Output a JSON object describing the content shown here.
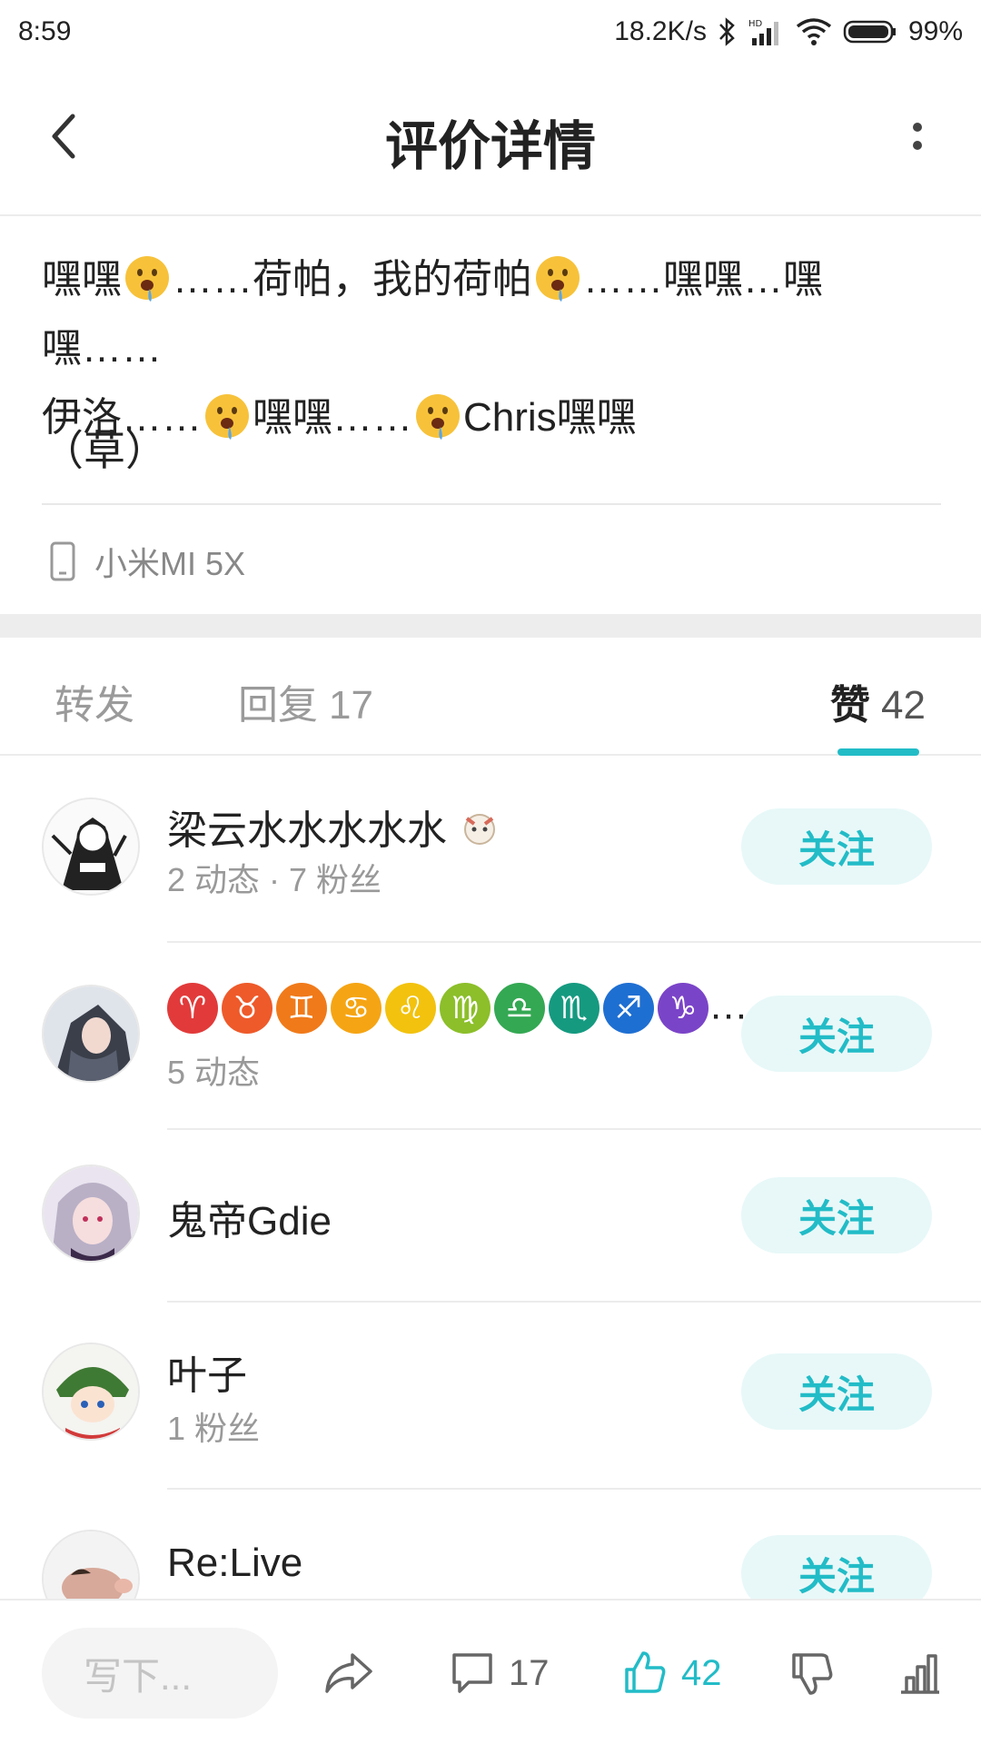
{
  "status_bar": {
    "time": "8:59",
    "network_speed": "18.2K/s",
    "battery": "99%",
    "icons": [
      "bluetooth-icon",
      "hd-signal-icon",
      "wifi-icon",
      "battery-icon"
    ]
  },
  "header": {
    "title": "评价详情",
    "back_icon": "back-arrow-icon",
    "more_icon": "more-vertical-icon"
  },
  "comment": {
    "seg1": "嘿嘿",
    "seg2": "……荷帕，我的荷帕",
    "seg3": "……嘿嘿…嘿嘿……",
    "seg4": "伊洛……",
    "seg5": "嘿嘿……",
    "seg6": "Chris嘿嘿",
    "paren_line": "（草）",
    "emoji": "drooling-face-emoji",
    "device": "小米MI 5X"
  },
  "tabs": {
    "repost": "转发",
    "reply": "回复",
    "reply_count": "17",
    "like": "赞",
    "like_count": "42",
    "active": "like"
  },
  "users": [
    {
      "name": "梁云水水水水水",
      "sub": "2 动态 · 7 粉丝",
      "follow": "关注"
    },
    {
      "name": "…",
      "sub": "5 动态",
      "follow": "关注",
      "zodiac": [
        "♈",
        "♉",
        "♊",
        "♋",
        "♌",
        "♍",
        "♎",
        "♏",
        "♐",
        "♑"
      ]
    },
    {
      "name": "鬼帝Gdie",
      "sub": "",
      "follow": "关注"
    },
    {
      "name": "叶子",
      "sub": "1 粉丝",
      "follow": "关注"
    },
    {
      "name": "Re:Live",
      "sub": "",
      "follow": "关注"
    }
  ],
  "bottom_bar": {
    "write_placeholder": "写下...",
    "comment_count": "17",
    "like_count": "42"
  },
  "colors": {
    "accent": "#22bcc7",
    "follow_bg": "#e8f8f8",
    "muted": "#999999"
  }
}
